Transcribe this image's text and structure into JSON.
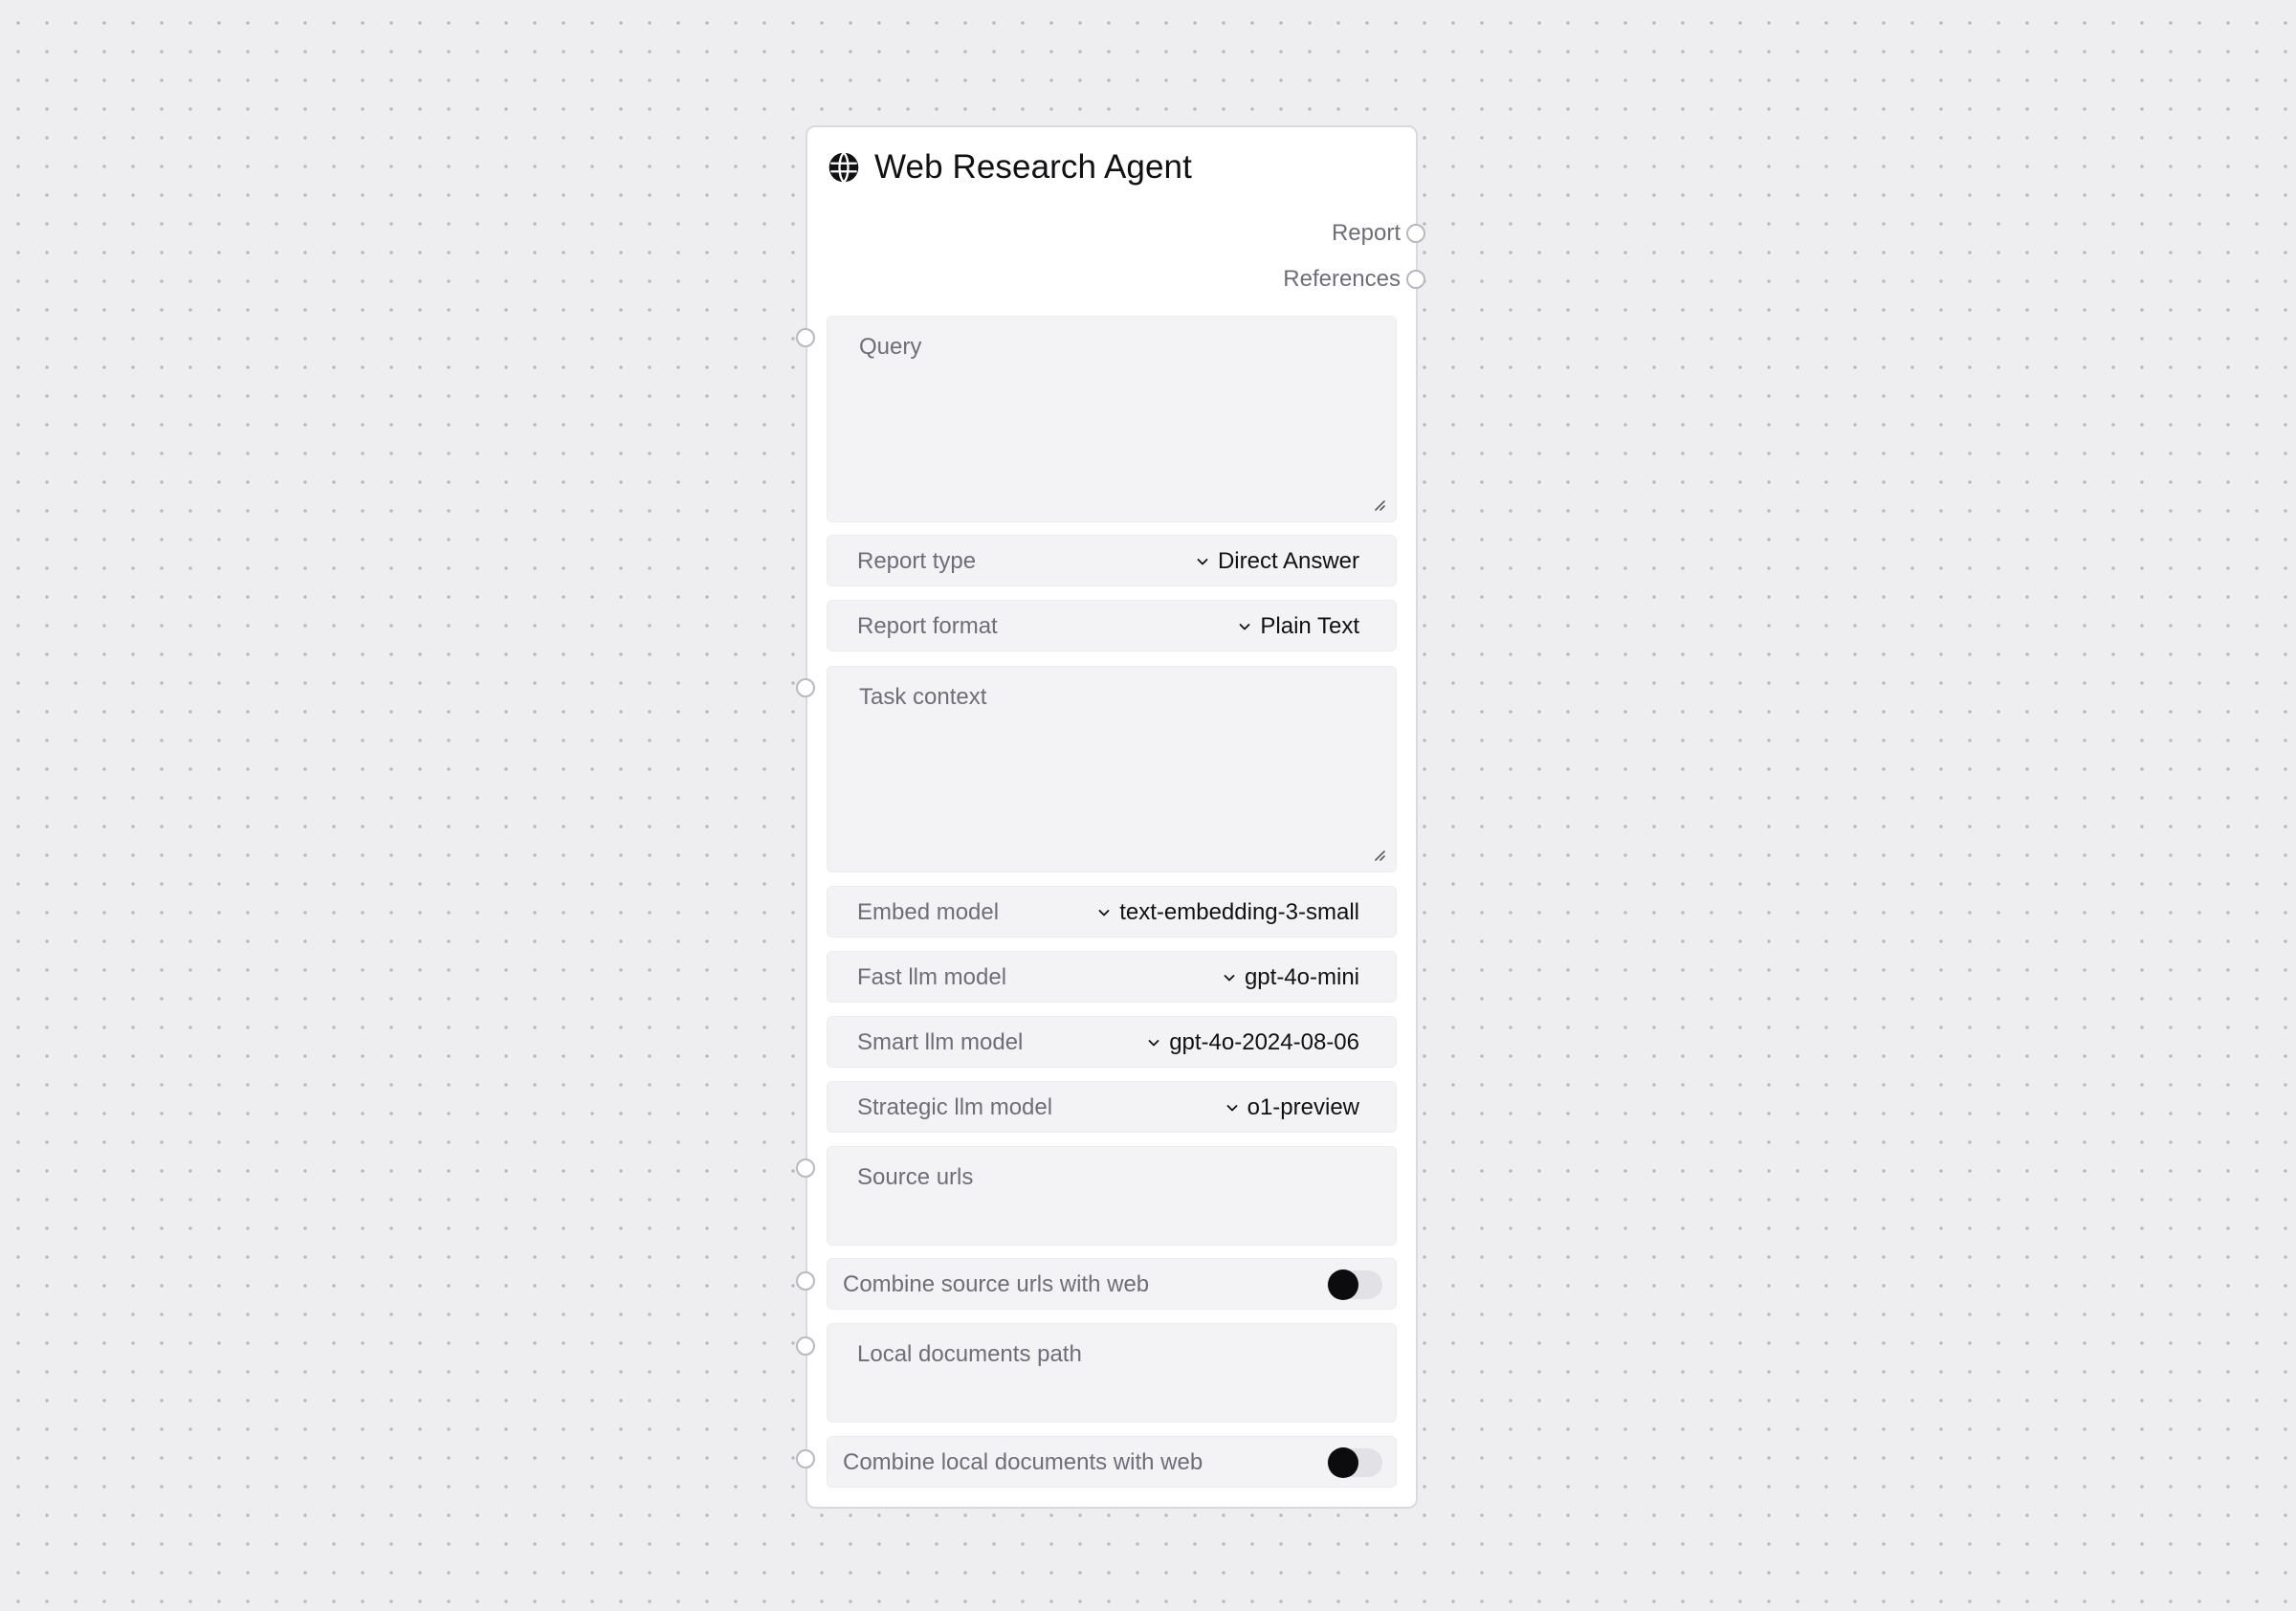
{
  "node": {
    "title": "Web Research Agent",
    "icon": "globe-icon",
    "outputs": [
      {
        "label": "Report"
      },
      {
        "label": "References"
      }
    ],
    "query": {
      "placeholder": "Query",
      "value": ""
    },
    "report_type": {
      "label": "Report type",
      "value": "Direct Answer"
    },
    "report_format": {
      "label": "Report format",
      "value": "Plain Text"
    },
    "task_context": {
      "placeholder": "Task context",
      "value": ""
    },
    "embed_model": {
      "label": "Embed model",
      "value": "text-embedding-3-small"
    },
    "fast_llm_model": {
      "label": "Fast llm model",
      "value": "gpt-4o-mini"
    },
    "smart_llm_model": {
      "label": "Smart llm model",
      "value": "gpt-4o-2024-08-06"
    },
    "strategic_llm_model": {
      "label": "Strategic llm model",
      "value": "o1-preview"
    },
    "source_urls": {
      "placeholder": "Source urls",
      "value": ""
    },
    "combine_source_urls": {
      "label": "Combine source urls with web",
      "on": false
    },
    "local_documents_path": {
      "placeholder": "Local documents path",
      "value": ""
    },
    "combine_local_documents": {
      "label": "Combine local documents with web",
      "on": false
    }
  },
  "colors": {
    "canvas": "#eeeef0",
    "node_bg": "#ffffff",
    "field_bg": "#f3f3f5",
    "muted_text": "#6e6e78",
    "value_text": "#111114",
    "toggle_knob": "#0c0c0e"
  }
}
